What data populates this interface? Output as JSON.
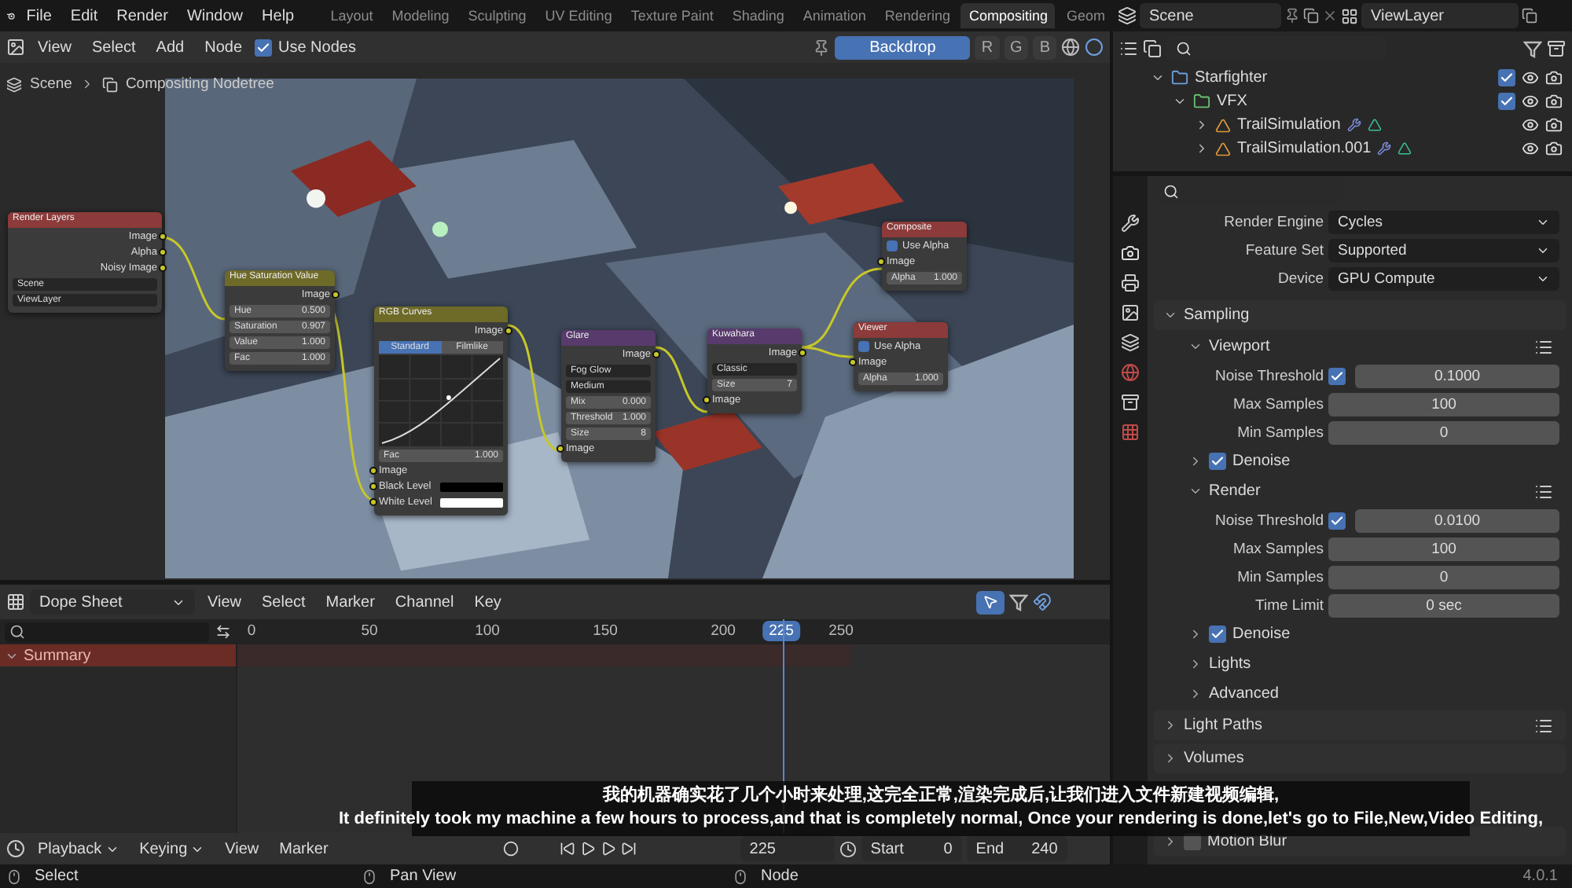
{
  "topbar": {
    "menus": [
      "File",
      "Edit",
      "Render",
      "Window",
      "Help"
    ],
    "workspaces": [
      {
        "label": "Layout",
        "selected": false
      },
      {
        "label": "Modeling",
        "selected": false
      },
      {
        "label": "Sculpting",
        "selected": false
      },
      {
        "label": "UV Editing",
        "selected": false
      },
      {
        "label": "Texture Paint",
        "selected": false
      },
      {
        "label": "Shading",
        "selected": false
      },
      {
        "label": "Animation",
        "selected": false
      },
      {
        "label": "Rendering",
        "selected": false
      },
      {
        "label": "Compositing",
        "selected": true
      },
      {
        "label": "Geom",
        "selected": false
      }
    ],
    "scene": "Scene",
    "view_layer": "ViewLayer"
  },
  "node_editor": {
    "menus": [
      "View",
      "Select",
      "Add",
      "Node"
    ],
    "use_nodes": {
      "label": "Use Nodes",
      "checked": true
    },
    "backdrop": {
      "label": "Backdrop",
      "selected": true
    },
    "channels": [
      {
        "label": "R",
        "selected": false
      },
      {
        "label": "G",
        "selected": false
      },
      {
        "label": "B",
        "selected": false
      }
    ],
    "breadcrumb": [
      "Scene",
      "Compositing Nodetree"
    ],
    "nodes": [
      {
        "title": "Render Layers",
        "kind": "input",
        "rows": [
          {
            "kind": "output",
            "label": "Image"
          },
          {
            "kind": "output",
            "label": "Alpha"
          },
          {
            "kind": "output",
            "label": "Noisy Image"
          },
          {
            "kind": "select",
            "label": "Scene"
          },
          {
            "kind": "select",
            "label": "ViewLayer"
          }
        ]
      },
      {
        "title": "Hue Saturation Value",
        "kind": "color",
        "rows": [
          {
            "kind": "output",
            "label": "Image"
          },
          {
            "kind": "field",
            "label": "Hue",
            "value": "0.500"
          },
          {
            "kind": "field",
            "label": "Saturation",
            "value": "0.907"
          },
          {
            "kind": "field",
            "label": "Value",
            "value": "1.000"
          },
          {
            "kind": "field",
            "label": "Fac",
            "value": "1.000"
          }
        ]
      },
      {
        "title": "RGB Curves",
        "kind": "color",
        "rows": [
          {
            "kind": "output",
            "label": "Image"
          },
          {
            "kind": "tabs",
            "options": [
              {
                "label": "Standard",
                "selected": true
              },
              {
                "label": "Filmlike",
                "selected": false
              }
            ]
          },
          {
            "kind": "curve"
          },
          {
            "kind": "field",
            "label": "Fac",
            "value": "1.000"
          },
          {
            "kind": "input",
            "label": "Image"
          },
          {
            "kind": "swatch",
            "label": "Black Level",
            "color": "#000000"
          },
          {
            "kind": "swatch",
            "label": "White Level",
            "color": "#ffffff"
          }
        ]
      },
      {
        "title": "Glare",
        "kind": "filter",
        "rows": [
          {
            "kind": "output",
            "label": "Image"
          },
          {
            "kind": "select",
            "label": "Fog Glow"
          },
          {
            "kind": "select",
            "label": "Medium"
          },
          {
            "kind": "field",
            "label": "Mix",
            "value": "0.000"
          },
          {
            "kind": "field",
            "label": "Threshold",
            "value": "1.000"
          },
          {
            "kind": "field",
            "label": "Size",
            "value": "8"
          },
          {
            "kind": "input",
            "label": "Image"
          }
        ]
      },
      {
        "title": "Kuwahara",
        "kind": "filter",
        "rows": [
          {
            "kind": "output",
            "label": "Image"
          },
          {
            "kind": "select",
            "label": "Classic"
          },
          {
            "kind": "field",
            "label": "Size",
            "value": "7"
          },
          {
            "kind": "input",
            "label": "Image"
          }
        ]
      },
      {
        "title": "Composite",
        "kind": "output",
        "rows": [
          {
            "kind": "check",
            "label": "Use Alpha",
            "checked": true
          },
          {
            "kind": "input",
            "label": "Image"
          },
          {
            "kind": "field",
            "label": "Alpha",
            "value": "1.000"
          }
        ]
      },
      {
        "title": "Viewer",
        "kind": "output",
        "rows": [
          {
            "kind": "check",
            "label": "Use Alpha",
            "checked": true
          },
          {
            "kind": "input",
            "label": "Image"
          },
          {
            "kind": "field",
            "label": "Alpha",
            "value": "1.000"
          }
        ]
      }
    ]
  },
  "dope_sheet": {
    "mode": "Dope Sheet",
    "menus": [
      "View",
      "Select",
      "Marker",
      "Channel",
      "Key"
    ],
    "ticks": [
      "0",
      "50",
      "100",
      "150",
      "200",
      "250"
    ],
    "current_frame": "225",
    "channels": [
      {
        "label": "Summary",
        "expanded": true
      }
    ]
  },
  "timeline": {
    "dropdowns": [
      "Playback",
      "Keying"
    ],
    "menus": [
      "View",
      "Marker"
    ],
    "frame": "225",
    "start_label": "Start",
    "start": "0",
    "end_label": "End",
    "end": "240"
  },
  "status_bar": {
    "hints": [
      "Select",
      "Pan View",
      "Node"
    ],
    "version": "4.0.1"
  },
  "outliner": {
    "tree": [
      {
        "label": "Starfighter",
        "kind": "collection",
        "expanded": true,
        "checked": true,
        "children": [
          {
            "label": "VFX",
            "kind": "collection",
            "expanded": true,
            "checked": true,
            "children": [
              {
                "label": "TrailSimulation",
                "kind": "object",
                "expanded": false
              },
              {
                "label": "TrailSimulation.001",
                "kind": "object",
                "expanded": false
              }
            ]
          }
        ]
      }
    ]
  },
  "properties": {
    "render_settings": [
      {
        "label": "Render Engine",
        "value": "Cycles"
      },
      {
        "label": "Feature Set",
        "value": "Supported"
      },
      {
        "label": "Device",
        "value": "GPU Compute"
      }
    ],
    "panels": [
      {
        "label": "Sampling",
        "expanded": true,
        "children": [
          {
            "kind": "subpanel",
            "label": "Viewport",
            "expanded": true,
            "presets": true,
            "children": [
              {
                "kind": "check_number",
                "label": "Noise Threshold",
                "checked": true,
                "value": "0.1000"
              },
              {
                "kind": "number",
                "label": "Max Samples",
                "value": "100"
              },
              {
                "kind": "number",
                "label": "Min Samples",
                "value": "0"
              }
            ]
          },
          {
            "kind": "check_subpanel",
            "label": "Denoise",
            "expanded": false,
            "checked": true
          },
          {
            "kind": "subpanel",
            "label": "Render",
            "expanded": true,
            "presets": true,
            "children": [
              {
                "kind": "check_number",
                "label": "Noise Threshold",
                "checked": true,
                "value": "0.0100"
              },
              {
                "kind": "number",
                "label": "Max Samples",
                "value": "100"
              },
              {
                "kind": "number",
                "label": "Min Samples",
                "value": "0"
              },
              {
                "kind": "number",
                "label": "Time Limit",
                "value": "0 sec"
              }
            ]
          },
          {
            "kind": "check_subpanel",
            "label": "Denoise",
            "expanded": false,
            "checked": true
          },
          {
            "kind": "subpanel",
            "label": "Lights",
            "expanded": false
          },
          {
            "kind": "subpanel",
            "label": "Advanced",
            "expanded": false
          }
        ]
      },
      {
        "label": "Light Paths",
        "expanded": false,
        "presets": true
      },
      {
        "label": "Volumes",
        "expanded": false
      },
      {
        "label": "Motion Blur",
        "expanded": false,
        "checked": false
      }
    ]
  },
  "subtitles": [
    "我的机器确实花了几个小时来处理,这完全正常,渲染完成后,让我们进入文件新建视频编辑,",
    "It definitely took my machine a few hours to process,and that is completely normal, Once your rendering is done,let's go to File,New,Video Editing,"
  ]
}
